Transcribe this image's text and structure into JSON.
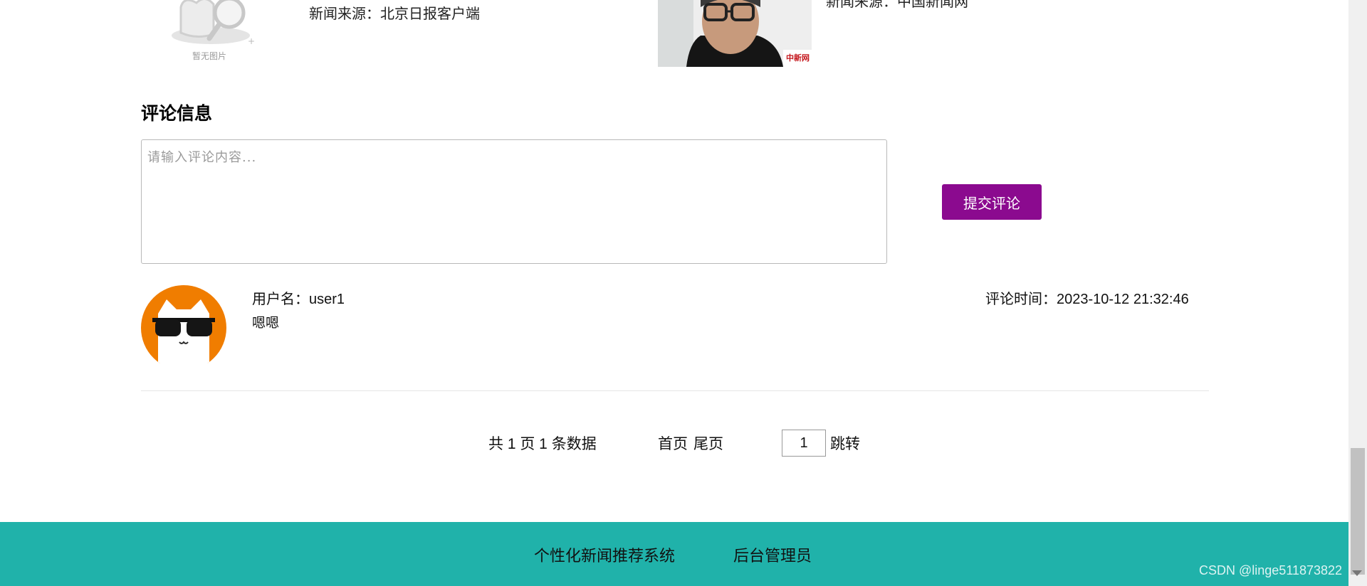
{
  "news_row": {
    "no_image_caption": "暂无图片",
    "source_left": "新闻来源：北京日报客户端",
    "photo_watermark": "中新网",
    "source_right": "新闻来源：中国新闻网"
  },
  "comments_section": {
    "title": "评论信息",
    "input": {
      "placeholder": "请输入评论内容...",
      "value": ""
    },
    "submit_label": "提交评论",
    "items": [
      {
        "username_label": "用户名：user1",
        "content": "嗯嗯",
        "time_label": "评论时间：2023-10-12 21:32:46"
      }
    ]
  },
  "pagination": {
    "summary": "共 1 页 1 条数据",
    "first_label": "首页",
    "last_label": "尾页",
    "page_value": "1",
    "jump_label": "跳转"
  },
  "footer": {
    "links": [
      "个性化新闻推荐系统",
      "后台管理员"
    ]
  },
  "watermark": "CSDN @linge511873822",
  "colors": {
    "submit_button": "#8b0a8f",
    "footer_bg": "#20b2aa",
    "avatar_bg": "#f07d00"
  },
  "icons": {
    "placeholder_image": "no-image-magnifier-icon",
    "avatar": "cat-with-sunglasses-avatar"
  }
}
